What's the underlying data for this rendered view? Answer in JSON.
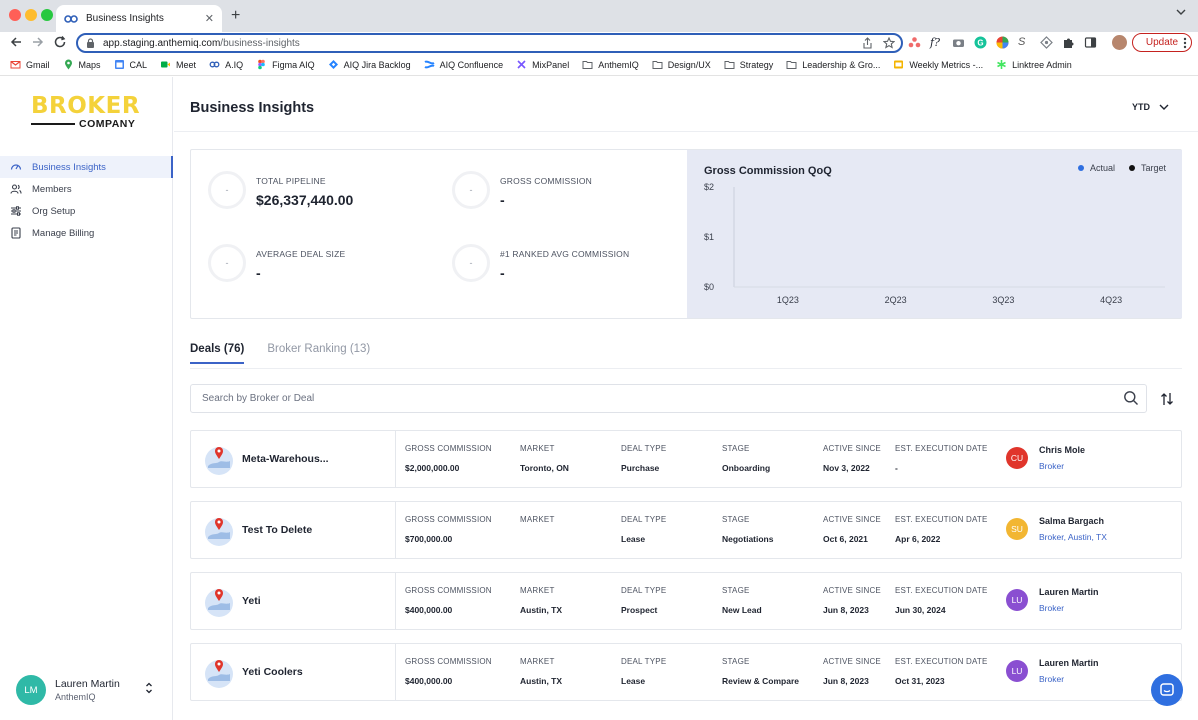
{
  "browser": {
    "tab_title": "Business Insights",
    "url_host": "app.staging.anthemiq.com",
    "url_path": "/business-insights",
    "update_label": "Update",
    "bookmarks": [
      "Gmail",
      "Maps",
      "CAL",
      "Meet",
      "A.IQ",
      "Figma AIQ",
      "AIQ Jira Backlog",
      "AIQ Confluence",
      "MixPanel",
      "AnthemIQ",
      "Design/UX",
      "Strategy",
      "Leadership & Gro...",
      "Weekly Metrics -...",
      "Linktree Admin"
    ]
  },
  "sidebar": {
    "logo_top": "BROKER",
    "logo_bottom": "COMPANY",
    "items": [
      {
        "label": "Business Insights",
        "icon": "gauge-icon"
      },
      {
        "label": "Members",
        "icon": "members-icon"
      },
      {
        "label": "Org Setup",
        "icon": "sliders-icon"
      },
      {
        "label": "Manage Billing",
        "icon": "billing-icon"
      }
    ],
    "user": {
      "initials": "LM",
      "name": "Lauren Martin",
      "org": "AnthemIQ"
    }
  },
  "header": {
    "title": "Business Insights",
    "period": "YTD"
  },
  "stats": {
    "total_pipeline": {
      "label": "TOTAL PIPELINE",
      "value": "$26,337,440.00",
      "ring": "-"
    },
    "gross_commission": {
      "label": "GROSS COMMISSION",
      "value": "-",
      "ring": "-"
    },
    "avg_deal_size": {
      "label": "AVERAGE DEAL SIZE",
      "value": "-",
      "ring": "-"
    },
    "ranked_avg": {
      "label": "#1 RANKED AVG COMMISSION",
      "value": "-",
      "ring": "-"
    }
  },
  "chart_data": {
    "type": "line",
    "title": "Gross Commission QoQ",
    "categories": [
      "1Q23",
      "2Q23",
      "3Q23",
      "4Q23"
    ],
    "series": [
      {
        "name": "Actual",
        "values": [],
        "color": "#2f6fe0"
      },
      {
        "name": "Target",
        "values": [],
        "color": "#111111"
      }
    ],
    "y_ticks": [
      "$2",
      "$1",
      "$0"
    ],
    "ylim": [
      0,
      2
    ],
    "legend": "top-right",
    "grid": false
  },
  "tabs": [
    {
      "label": "Deals",
      "count": "(76)"
    },
    {
      "label": "Broker Ranking",
      "count": "(13)"
    }
  ],
  "search": {
    "placeholder": "Search by Broker or Deal"
  },
  "columns": {
    "gross_commission": "GROSS COMMISSION",
    "market": "MARKET",
    "deal_type": "DEAL TYPE",
    "stage": "STAGE",
    "active_since": "ACTIVE SINCE",
    "execution_date": "EST. EXECUTION DATE"
  },
  "deals": [
    {
      "name": "Meta-Warehous...",
      "gross_commission": "$2,000,000.00",
      "market": "Toronto, ON",
      "deal_type": "Purchase",
      "stage": "Onboarding",
      "active_since": "Nov 3, 2022",
      "execution_date": "-",
      "owner_initials": "CU",
      "owner_color": "#e0352b",
      "owner_name": "Chris Mole",
      "owner_role": "Broker"
    },
    {
      "name": "Test To Delete",
      "gross_commission": "$700,000.00",
      "market": "",
      "deal_type": "Lease",
      "stage": "Negotiations",
      "active_since": "Oct 6, 2021",
      "execution_date": "Apr 6, 2022",
      "owner_initials": "SU",
      "owner_color": "#f2b632",
      "owner_name": "Salma Bargach",
      "owner_role": "Broker, Austin, TX"
    },
    {
      "name": "Yeti",
      "gross_commission": "$400,000.00",
      "market": "Austin, TX",
      "deal_type": "Prospect",
      "stage": "New Lead",
      "active_since": "Jun 8, 2023",
      "execution_date": "Jun 30, 2024",
      "owner_initials": "LU",
      "owner_color": "#8a4fd1",
      "owner_name": "Lauren Martin",
      "owner_role": "Broker"
    },
    {
      "name": "Yeti Coolers",
      "gross_commission": "$400,000.00",
      "market": "Austin, TX",
      "deal_type": "Lease",
      "stage": "Review & Compare",
      "active_since": "Jun 8, 2023",
      "execution_date": "Oct 31, 2023",
      "owner_initials": "LU",
      "owner_color": "#8a4fd1",
      "owner_name": "Lauren Martin",
      "owner_role": "Broker"
    }
  ]
}
